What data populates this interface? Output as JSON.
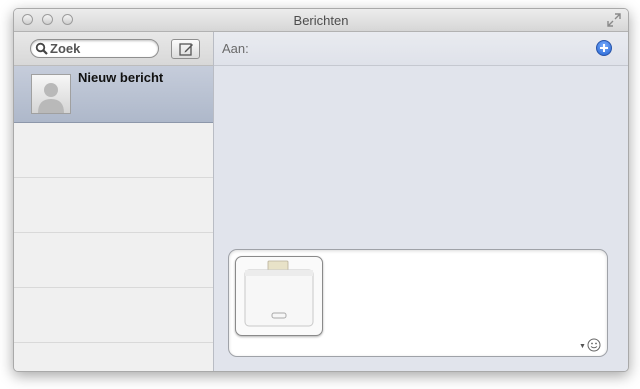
{
  "window": {
    "title": "Berichten"
  },
  "sidebar": {
    "search": {
      "placeholder": "Zoek"
    },
    "conversations": [
      {
        "name": "Nieuw bericht"
      }
    ]
  },
  "main": {
    "to_label": "Aan:"
  },
  "icons": {
    "traffic_lights": [
      "close-icon",
      "minimize-icon",
      "zoom-icon"
    ],
    "fullscreen": "fullscreen-icon",
    "search": "search-icon",
    "compose": "compose-icon",
    "add_recipient": "plus-icon",
    "emoji": "smiley-icon"
  }
}
